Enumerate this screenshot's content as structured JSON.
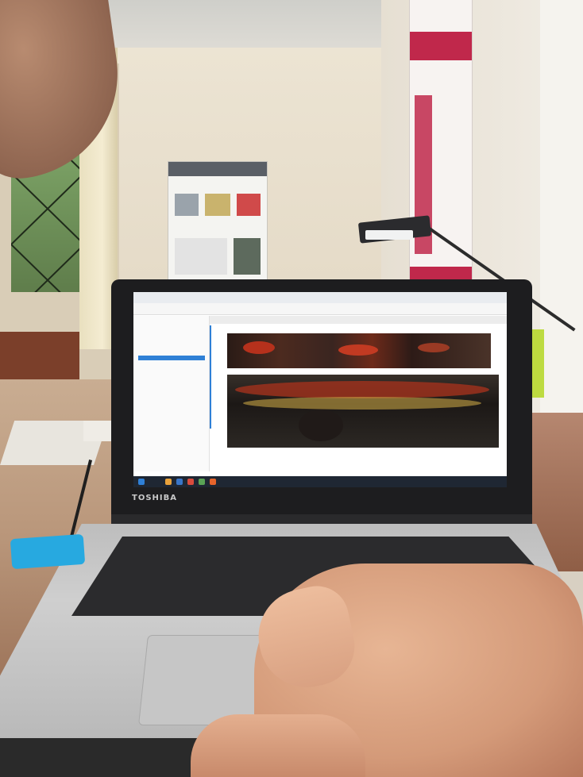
{
  "scene": {
    "laptop_brand": "TOSHIBA"
  },
  "screen": {
    "file_items": [
      "",
      "",
      "",
      "",
      "",
      "",
      "",
      ""
    ],
    "selected_index": 4
  },
  "colors": {
    "accent_blue": "#2f80d6",
    "poster_red": "#c0284b",
    "usb_blue": "#27a9e0",
    "lamp_black": "#2b2b2e"
  }
}
